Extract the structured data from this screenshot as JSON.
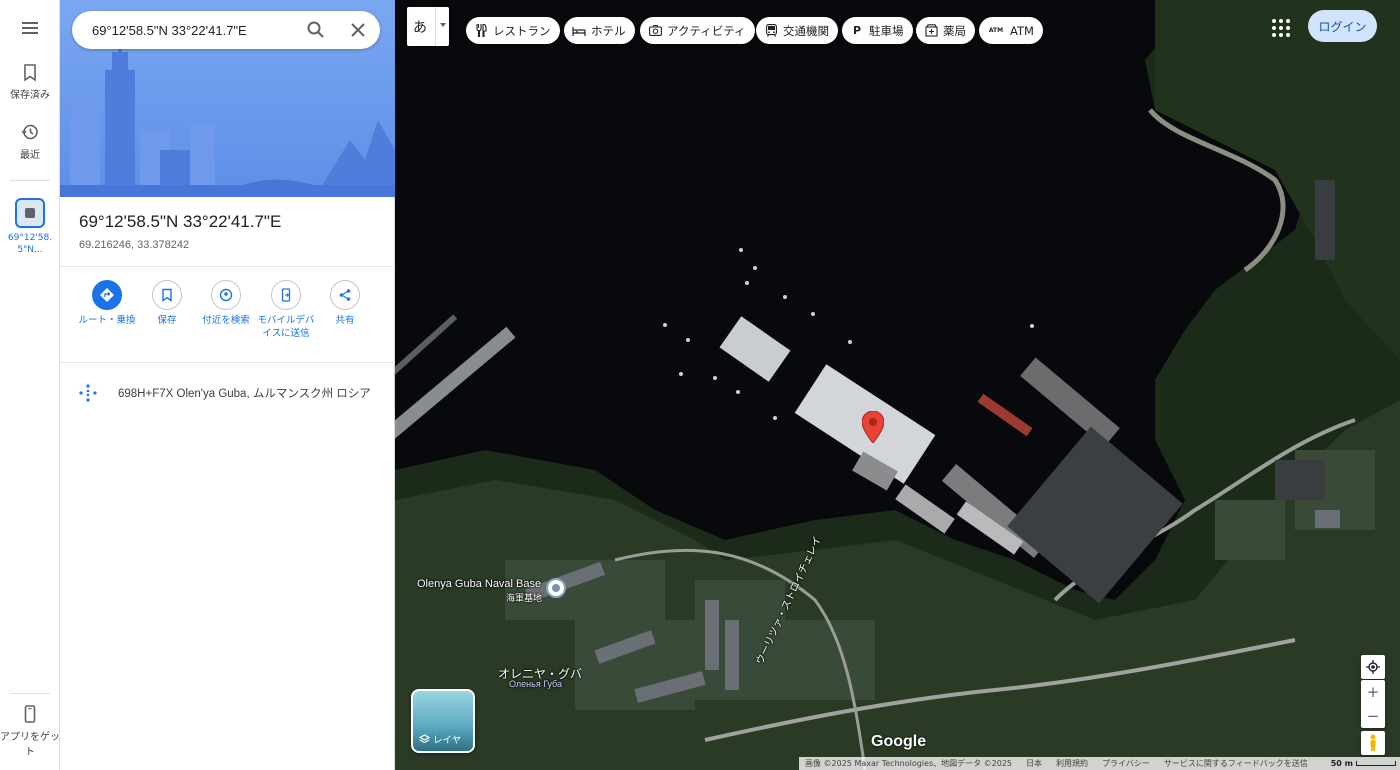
{
  "rail": {
    "menu_icon": "hamburger-icon",
    "saved_label": "保存済み",
    "recent_label": "最近",
    "recent_item_label": "69°12'58.5\"N...",
    "get_app_label": "アプリをゲット"
  },
  "search": {
    "value": "69°12'58.5\"N 33°22'41.7\"E",
    "search_icon": "search-icon",
    "clear_icon": "close-icon"
  },
  "place": {
    "title": "69°12'58.5\"N 33°22'41.7\"E",
    "decimal_coords": "69.216246, 33.378242"
  },
  "actions": [
    {
      "label": "ルート・乗換",
      "icon": "directions-icon"
    },
    {
      "label": "保存",
      "icon": "bookmark-icon"
    },
    {
      "label": "付近を検索",
      "icon": "nearby-icon"
    },
    {
      "label": "モバイルデバイスに送信",
      "icon": "send-to-phone-icon"
    },
    {
      "label": "共有",
      "icon": "share-icon"
    }
  ],
  "plus_code": {
    "icon": "plus-code-icon",
    "text": "698H+F7X Olen'ya Guba, ムルマンスク州 ロシア"
  },
  "map": {
    "language_button": "あ",
    "chips": [
      {
        "label": "レストラン",
        "icon": "restaurant-icon"
      },
      {
        "label": "ホテル",
        "icon": "hotel-icon"
      },
      {
        "label": "アクティビティ",
        "icon": "camera-icon"
      },
      {
        "label": "交通機関",
        "icon": "transit-icon"
      },
      {
        "label": "駐車場",
        "icon": "parking-icon"
      },
      {
        "label": "薬局",
        "icon": "pharmacy-icon"
      },
      {
        "label": "ATM",
        "icon": "atm-icon"
      }
    ],
    "login_label": "ログイン",
    "labels": {
      "base_name": "Olenya Guba Naval Base",
      "base_type": "海軍基地",
      "town_jp": "オレニヤ・グバ",
      "town_ru": "Оленья Губа",
      "street": "ウーリツァ・ストロイチェレイ"
    },
    "layers_label": "レイヤ",
    "google_logo": "Google",
    "footer": {
      "imagery": "画像 ©2025 Maxar Technologies、地図データ ©2025",
      "region": "日本",
      "terms": "利用規約",
      "privacy": "プライバシー",
      "feedback": "サービスに関するフィードバックを送信",
      "scale": "50 m"
    },
    "accent_color": "#1a73e8",
    "pin_color": "#ea4335"
  }
}
